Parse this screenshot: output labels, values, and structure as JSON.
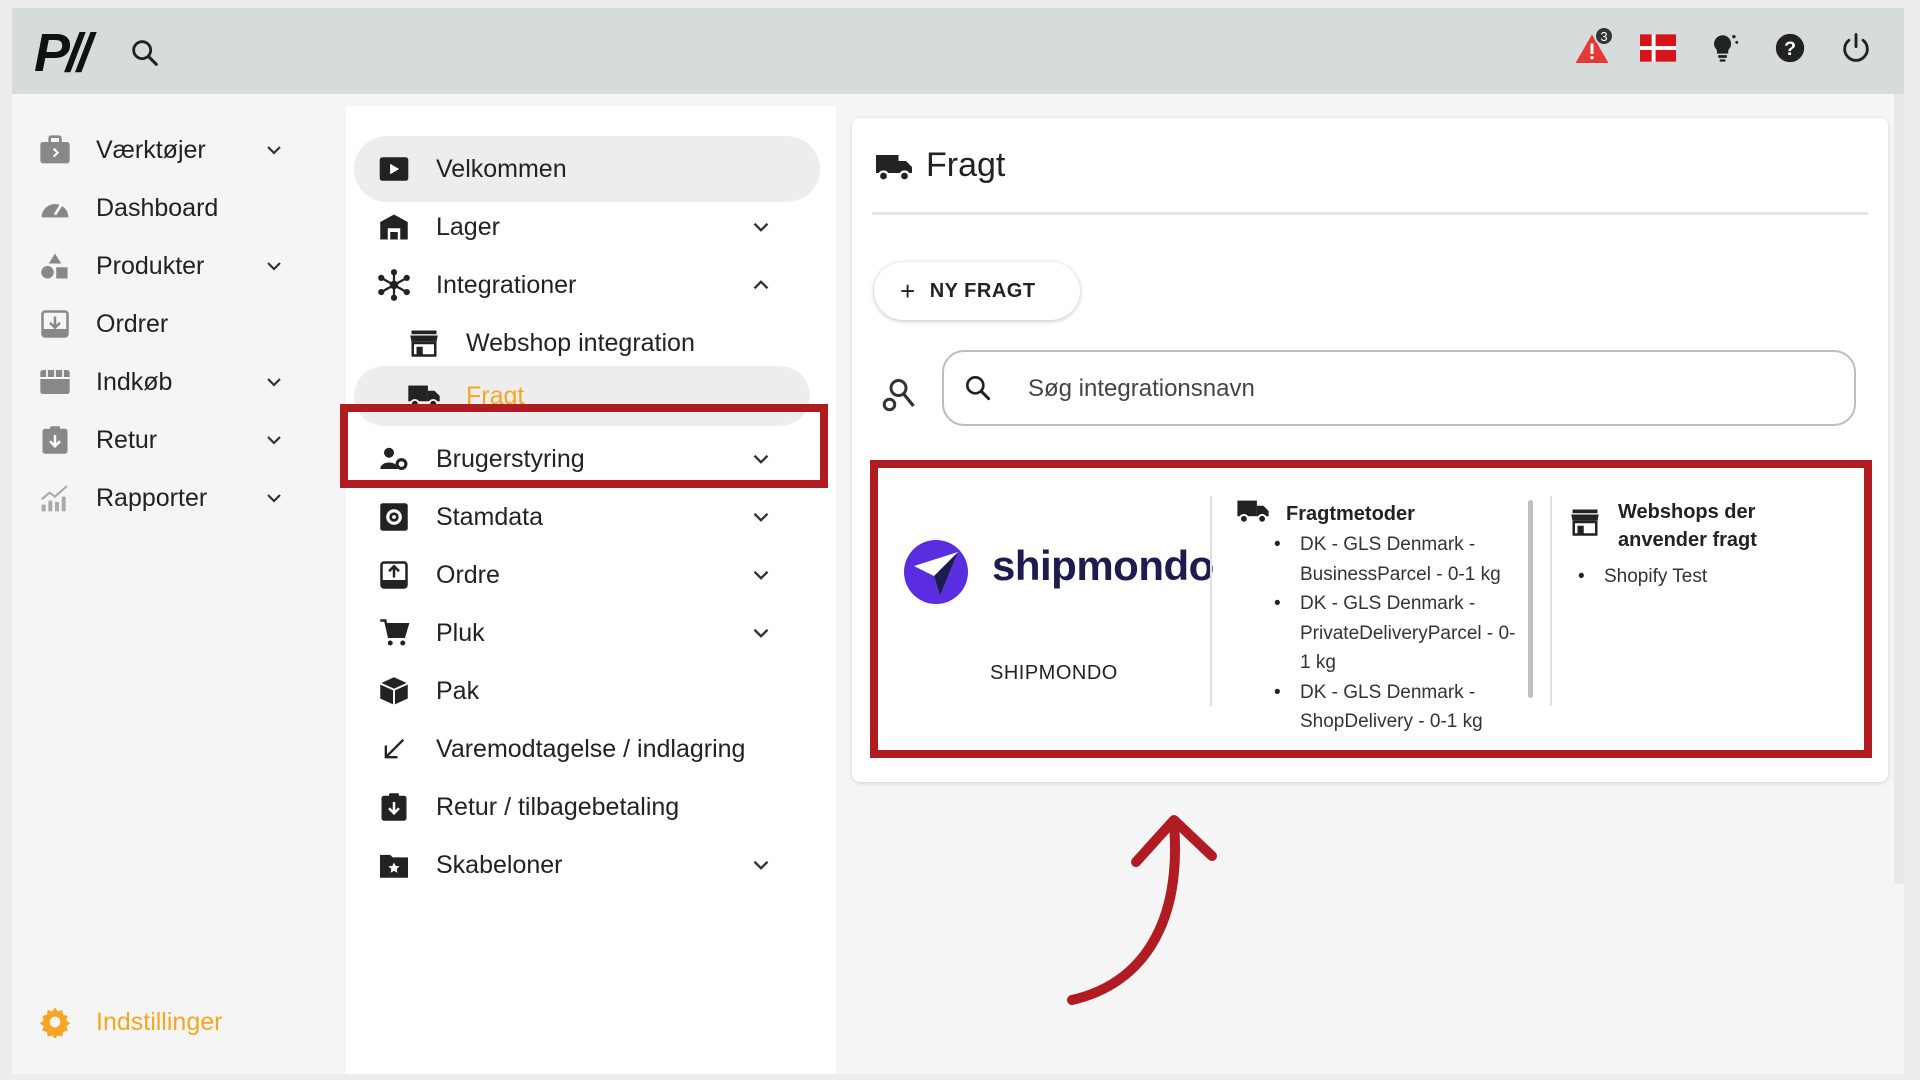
{
  "logo": "P//",
  "topbar": {
    "notification_count": "3",
    "icons": [
      "search-icon",
      "warning-icon",
      "danish-flag-icon",
      "lightbulb-icon",
      "help-icon",
      "power-icon"
    ]
  },
  "leftnav": {
    "items": [
      {
        "label": "Værktøjer",
        "icon": "toolbox-icon",
        "chevron": true
      },
      {
        "label": "Dashboard",
        "icon": "gauge-icon",
        "chevron": false
      },
      {
        "label": "Produkter",
        "icon": "shapes-icon",
        "chevron": true
      },
      {
        "label": "Ordrer",
        "icon": "download-box-icon",
        "chevron": false
      },
      {
        "label": "Indkøb",
        "icon": "store-icon",
        "chevron": true
      },
      {
        "label": "Retur",
        "icon": "return-box-icon",
        "chevron": true
      },
      {
        "label": "Rapporter",
        "icon": "chart-icon",
        "chevron": true
      }
    ],
    "settings_label": "Indstillinger"
  },
  "settings_menu": {
    "items": [
      {
        "label": "Velkommen",
        "icon": "play-icon"
      },
      {
        "label": "Lager",
        "icon": "warehouse-icon",
        "chevron": "down"
      },
      {
        "label": "Integrationer",
        "icon": "hub-icon",
        "chevron": "up"
      },
      {
        "label": "Webshop integration",
        "icon": "shop-icon"
      },
      {
        "label": "Fragt",
        "icon": "truck-icon"
      },
      {
        "label": "Brugerstyring",
        "icon": "user-gear-icon",
        "chevron": "down"
      },
      {
        "label": "Stamdata",
        "icon": "gear-box-icon",
        "chevron": "down"
      },
      {
        "label": "Ordre",
        "icon": "download-box-icon",
        "chevron": "down"
      },
      {
        "label": "Pluk",
        "icon": "cart-icon",
        "chevron": "down"
      },
      {
        "label": "Pak",
        "icon": "package-icon"
      },
      {
        "label": "Varemodtagelse / indlagring",
        "icon": "arrow-down-left-icon"
      },
      {
        "label": "Retur / tilbagebetaling",
        "icon": "return-box-icon"
      },
      {
        "label": "Skabeloner",
        "icon": "folder-star-icon",
        "chevron": "down"
      }
    ]
  },
  "content": {
    "title": "Fragt",
    "new_button": "NY FRAGT",
    "search_placeholder": "Søg integrationsnavn",
    "card": {
      "logo_text": "shipmondo",
      "caption": "SHIPMONDO",
      "methods_title": "Fragtmetoder",
      "methods": [
        "DK - GLS Denmark - BusinessParcel - 0-1 kg",
        "DK - GLS Denmark - PrivateDeliveryParcel - 0-1 kg",
        "DK - GLS Denmark - ShopDelivery - 0-1 kg"
      ],
      "shops_title": "Webshops der anvender fragt",
      "shops": [
        "Shopify Test"
      ]
    }
  },
  "colors": {
    "accent": "#f5a623",
    "highlight_box": "#b01c22",
    "topbar": "#d6dbdb",
    "shipmondo": "#5a2ee0"
  }
}
